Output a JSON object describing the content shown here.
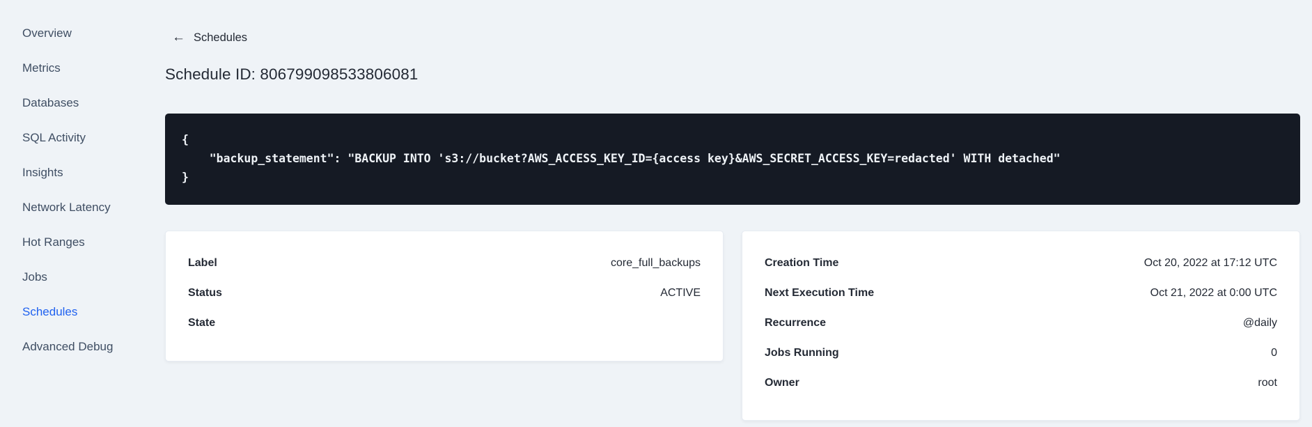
{
  "colors": {
    "page_background": "#eff3f7",
    "accent_blue": "#2062f0",
    "code_background": "#151a24",
    "text_dark": "#242a35"
  },
  "sidebar": {
    "items": [
      {
        "label": "Overview",
        "active": false
      },
      {
        "label": "Metrics",
        "active": false
      },
      {
        "label": "Databases",
        "active": false
      },
      {
        "label": "SQL Activity",
        "active": false
      },
      {
        "label": "Insights",
        "active": false
      },
      {
        "label": "Network Latency",
        "active": false
      },
      {
        "label": "Hot Ranges",
        "active": false
      },
      {
        "label": "Jobs",
        "active": false
      },
      {
        "label": "Schedules",
        "active": true
      },
      {
        "label": "Advanced Debug",
        "active": false
      }
    ]
  },
  "header": {
    "back_icon": "back-arrow",
    "back_label": "Schedules",
    "page_title": "Schedule ID: 806799098533806081"
  },
  "code_block": {
    "content": "{\n    \"backup_statement\": \"BACKUP INTO 's3://bucket?AWS_ACCESS_KEY_ID={access key}&AWS_SECRET_ACCESS_KEY=redacted' WITH detached\"\n}"
  },
  "details_card": {
    "rows": [
      {
        "label": "Label",
        "value": "core_full_backups"
      },
      {
        "label": "Status",
        "value": "ACTIVE"
      },
      {
        "label": "State",
        "value": ""
      }
    ]
  },
  "execution_card": {
    "rows": [
      {
        "label": "Creation Time",
        "value": "Oct 20, 2022 at 17:12 UTC"
      },
      {
        "label": "Next Execution Time",
        "value": "Oct 21, 2022 at 0:00 UTC"
      },
      {
        "label": "Recurrence",
        "value": "@daily"
      },
      {
        "label": "Jobs Running",
        "value": "0"
      },
      {
        "label": "Owner",
        "value": "root"
      }
    ]
  }
}
